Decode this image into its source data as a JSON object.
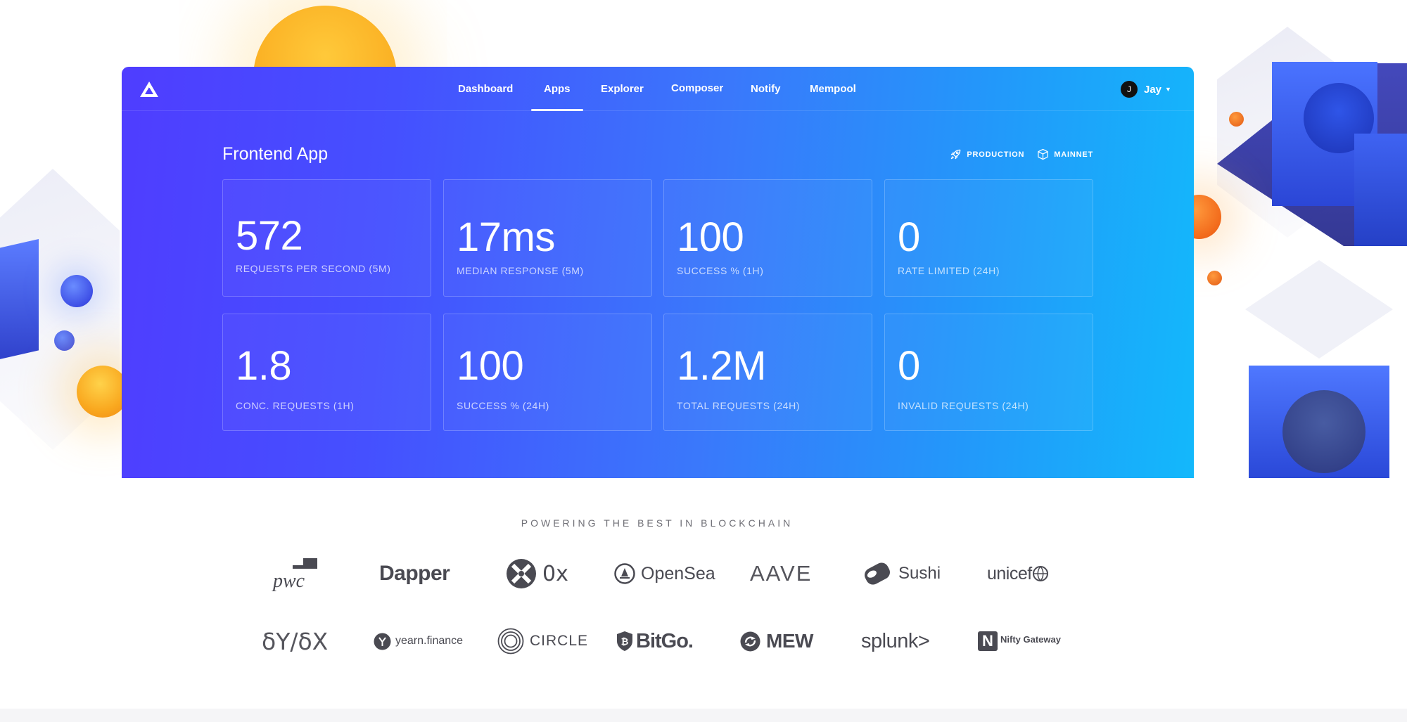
{
  "nav": {
    "items": [
      {
        "label": "Dashboard",
        "active": false
      },
      {
        "label": "Apps",
        "active": true
      },
      {
        "label": "Explorer",
        "active": false
      },
      {
        "label": "Composer",
        "active": false
      },
      {
        "label": "Notify",
        "active": false
      },
      {
        "label": "Mempool",
        "active": false
      }
    ],
    "user": {
      "initial": "J",
      "name": "Jay"
    }
  },
  "app": {
    "title": "Frontend App",
    "badges": [
      {
        "icon": "rocket-icon",
        "label": "PRODUCTION"
      },
      {
        "icon": "cube-icon",
        "label": "MAINNET"
      }
    ]
  },
  "stats": [
    {
      "value": "572",
      "label": "REQUESTS PER SECOND (5M)"
    },
    {
      "value": "17ms",
      "label": "MEDIAN RESPONSE (5M)"
    },
    {
      "value": "100",
      "label": "SUCCESS % (1H)"
    },
    {
      "value": "0",
      "label": "RATE LIMITED (24H)"
    },
    {
      "value": "1.8",
      "label": "CONC. REQUESTS (1H)"
    },
    {
      "value": "100",
      "label": "SUCCESS % (24H)"
    },
    {
      "value": "1.2M",
      "label": "TOTAL REQUESTS (24H)"
    },
    {
      "value": "0",
      "label": "INVALID REQUESTS (24H)"
    }
  ],
  "partners": {
    "heading": "POWERING THE BEST IN BLOCKCHAIN",
    "row1": [
      "pwc",
      "Dapper",
      "0x",
      "OpenSea",
      "AAVE",
      "Sushi",
      "unicef"
    ],
    "row2": [
      "δY/δX",
      "yearn.finance",
      "CIRCLE",
      "BitGo.",
      "MEW",
      "splunk>",
      "Nifty Gateway"
    ]
  },
  "colors": {
    "panel_gradient_start": "#4f3dff",
    "panel_gradient_end": "#13b8fb",
    "logo_gray": "#4a4a52"
  }
}
